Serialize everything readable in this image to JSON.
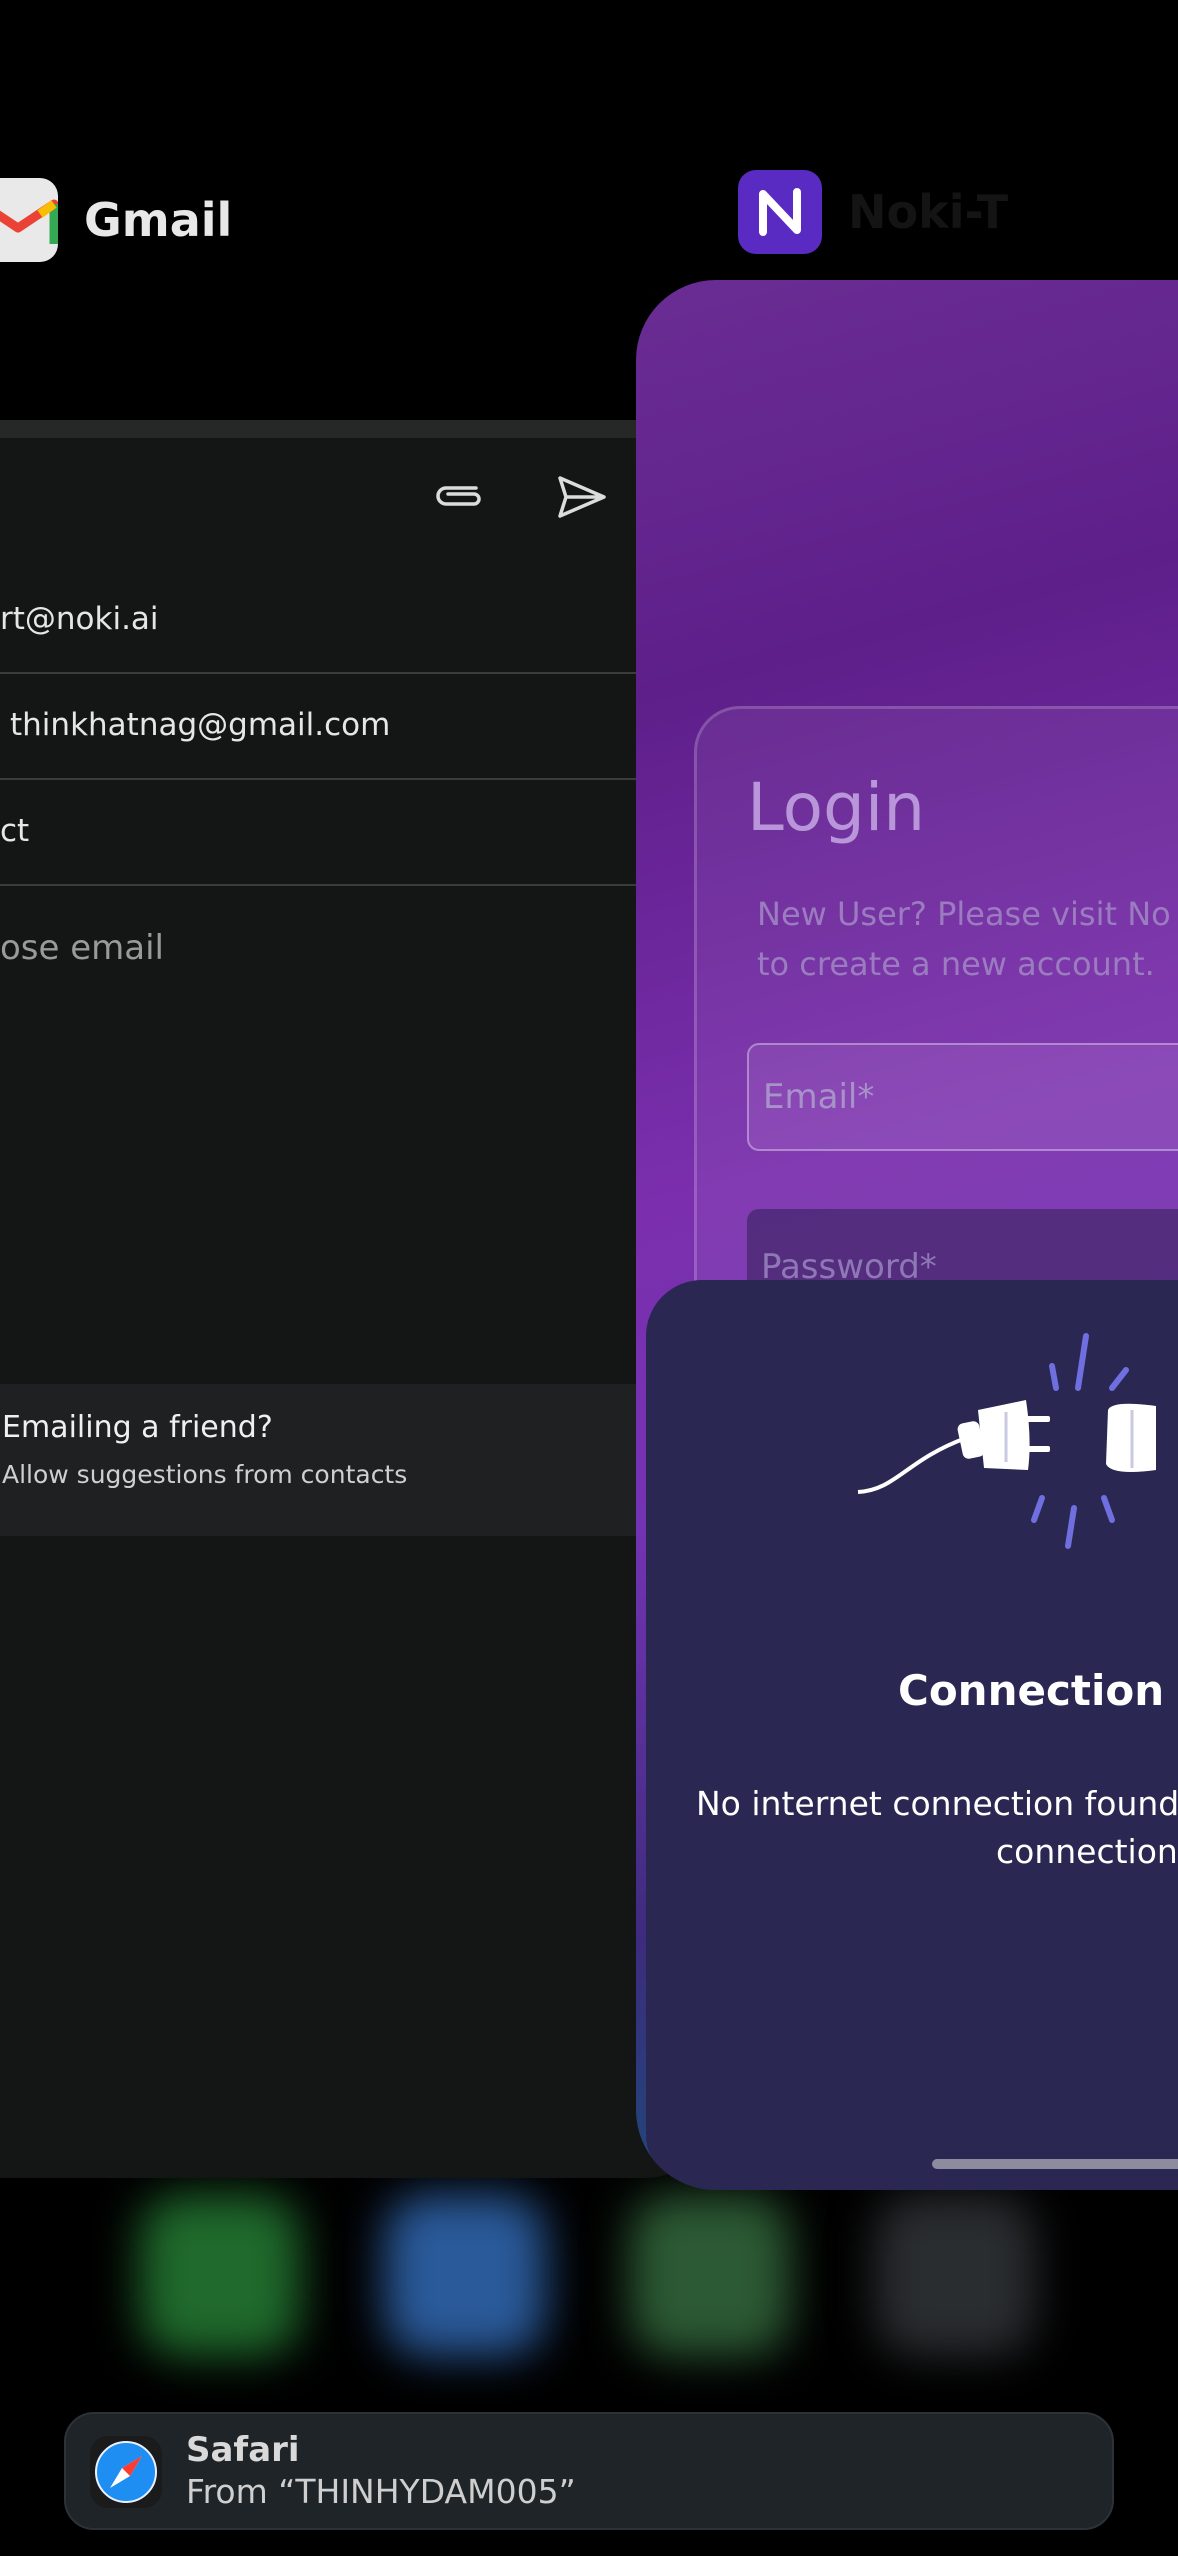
{
  "apps": {
    "gmail": {
      "label": "Gmail",
      "from_value": "rt@noki.ai",
      "to_value": "thinkhatnag@gmail.com",
      "subject_value": "ct",
      "compose_placeholder": "ose email",
      "suggestion_title": "Emailing a friend?",
      "suggestion_sub": "Allow suggestions from contacts"
    },
    "noki": {
      "label": "Noki-T",
      "login_title": "Login",
      "login_sub_line1": "New User? Please visit No",
      "login_sub_line2": "to create a new account.",
      "email_placeholder": "Email*",
      "password_placeholder": "Password*",
      "dialog_title": "Connection Lo",
      "dialog_msg_line1": "No internet connection found. I",
      "dialog_msg_line2": "connection."
    }
  },
  "handoff": {
    "app": "Safari",
    "source": "From “THINHYDAM005”"
  },
  "colors": {
    "noki_icon": "#5a2bc2",
    "dialog_bg": "#2a2752",
    "gmail_bg": "#141515"
  }
}
